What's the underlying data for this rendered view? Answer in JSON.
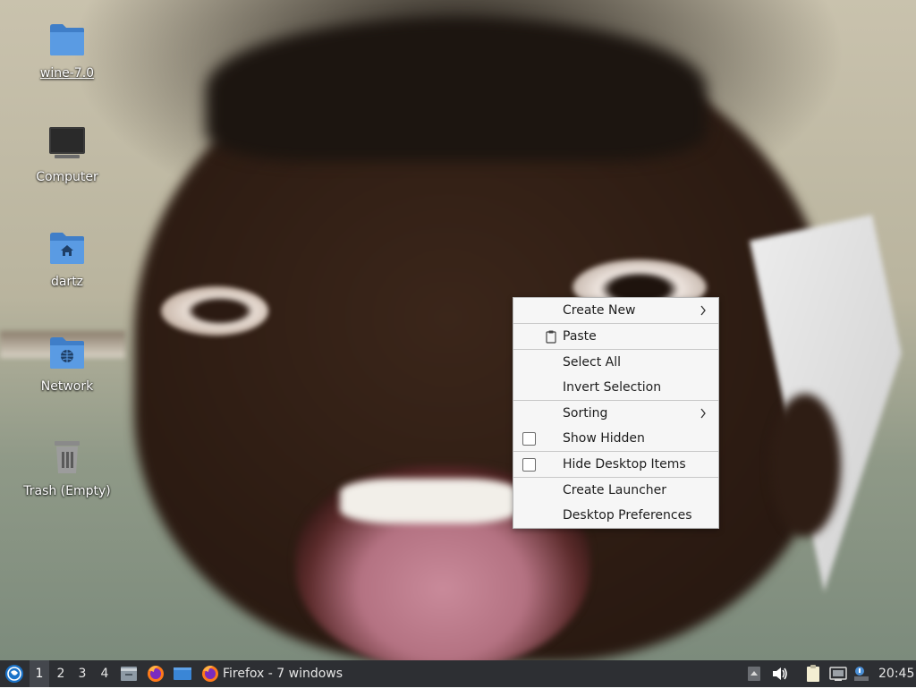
{
  "desktop": {
    "icons": [
      {
        "label": "wine-7.0",
        "icon": "folder-icon"
      },
      {
        "label": "Computer",
        "icon": "computer-icon"
      },
      {
        "label": "dartz",
        "icon": "home-folder-icon"
      },
      {
        "label": "Network",
        "icon": "network-folder-icon"
      },
      {
        "label": "Trash (Empty)",
        "icon": "trash-icon"
      }
    ]
  },
  "context_menu": {
    "items": [
      {
        "label": "Create New",
        "submenu": true
      },
      {
        "label": "Paste",
        "icon": "paste-icon"
      },
      {
        "label": "Select All"
      },
      {
        "label": "Invert Selection"
      },
      {
        "label": "Sorting",
        "submenu": true
      },
      {
        "label": "Show Hidden",
        "checkbox": false
      },
      {
        "label": "Hide Desktop Items",
        "checkbox": false
      },
      {
        "label": "Create Launcher"
      },
      {
        "label": "Desktop Preferences"
      }
    ]
  },
  "taskbar": {
    "workspaces": [
      "1",
      "2",
      "3",
      "4"
    ],
    "active_workspace": "1",
    "task_label": "Firefox - 7 windows",
    "clock": "20:45"
  },
  "colors": {
    "taskbar_bg": "#2d2f33",
    "folder_blue": "#4a90d9",
    "menu_bg": "#f6f6f6"
  }
}
